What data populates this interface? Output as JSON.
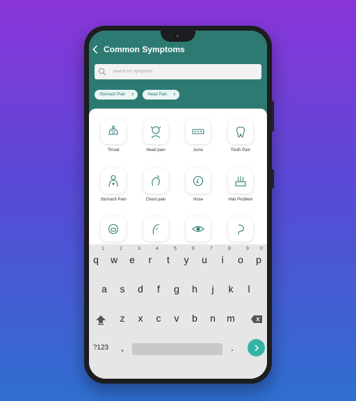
{
  "header": {
    "title": "Common Symptoms"
  },
  "search": {
    "placeholder": "Search for Symptoms"
  },
  "chips": [
    {
      "label": "Stomach Pain",
      "remove": "x"
    },
    {
      "label": "Head Pain",
      "remove": "x"
    }
  ],
  "symptoms": [
    {
      "label": "Throat",
      "icon": "throat-icon"
    },
    {
      "label": "Head pain",
      "icon": "head-pain-icon"
    },
    {
      "label": "Acne",
      "icon": "acne-icon"
    },
    {
      "label": "Tooth Pain",
      "icon": "tooth-icon"
    },
    {
      "label": "Stomach Pain",
      "icon": "stomach-pain-icon"
    },
    {
      "label": "Chest pain",
      "icon": "chest-pain-icon"
    },
    {
      "label": "Nose",
      "icon": "nose-icon"
    },
    {
      "label": "Hair Problem",
      "icon": "hair-problem-icon"
    },
    {
      "label": "",
      "icon": "mouth-icon"
    },
    {
      "label": "",
      "icon": "skin-icon"
    },
    {
      "label": "",
      "icon": "eye-icon"
    },
    {
      "label": "",
      "icon": "intestine-icon"
    }
  ],
  "keyboard": {
    "row1": [
      "q",
      "w",
      "e",
      "r",
      "t",
      "y",
      "u",
      "i",
      "o",
      "p"
    ],
    "digits": [
      "1",
      "2",
      "3",
      "4",
      "5",
      "6",
      "7",
      "8",
      "9",
      "0"
    ],
    "row2": [
      "a",
      "s",
      "d",
      "f",
      "g",
      "h",
      "j",
      "k",
      "l"
    ],
    "row3": [
      "z",
      "x",
      "c",
      "v",
      "b",
      "n",
      "m"
    ],
    "mode_key": "?123",
    "comma": ",",
    "period": "."
  },
  "colors": {
    "primary": "#2d7a73",
    "accent": "#34b3a5"
  }
}
